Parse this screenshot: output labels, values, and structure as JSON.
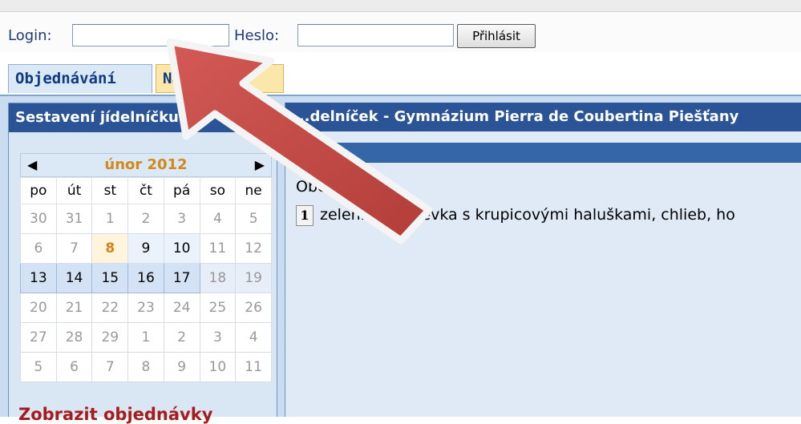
{
  "login": {
    "login_label": "Login:",
    "login_value": "",
    "password_label": "Heslo:",
    "password_value": "",
    "submit_label": "Přihlásit"
  },
  "tabs": [
    {
      "label": "Objednávání"
    },
    {
      "label": "Na..."
    }
  ],
  "left_panel": {
    "title": "Sestavení jídelníčku",
    "calendar": {
      "month_label": "únor 2012",
      "weekdays": [
        "po",
        "út",
        "st",
        "čt",
        "pá",
        "so",
        "ne"
      ],
      "weeks": [
        [
          "30",
          "31",
          "1",
          "2",
          "3",
          "4",
          "5"
        ],
        [
          "6",
          "7",
          "8",
          "9",
          "10",
          "11",
          "12"
        ],
        [
          "13",
          "14",
          "15",
          "16",
          "17",
          "18",
          "19"
        ],
        [
          "20",
          "21",
          "22",
          "23",
          "24",
          "25",
          "26"
        ],
        [
          "27",
          "28",
          "29",
          "1",
          "2",
          "3",
          "4"
        ],
        [
          "5",
          "6",
          "7",
          "8",
          "9",
          "10",
          "11"
        ]
      ]
    },
    "orders_link": "Zobrazit objednávky"
  },
  "right_panel": {
    "title": "...delníček - Gymnázium Pierra de Coubertina Piešťany",
    "day_line": "Obě... ...12",
    "meal_number": "1",
    "meal_text": "zelenin... polievka s krupicovými haluškami, chlieb, ho"
  },
  "colors": {
    "header_blue": "#2a5495",
    "panel_blue": "#d9e6f4",
    "today_orange": "#d9801a",
    "link_red": "#a41c1c",
    "arrow_red": "#c24a45"
  }
}
